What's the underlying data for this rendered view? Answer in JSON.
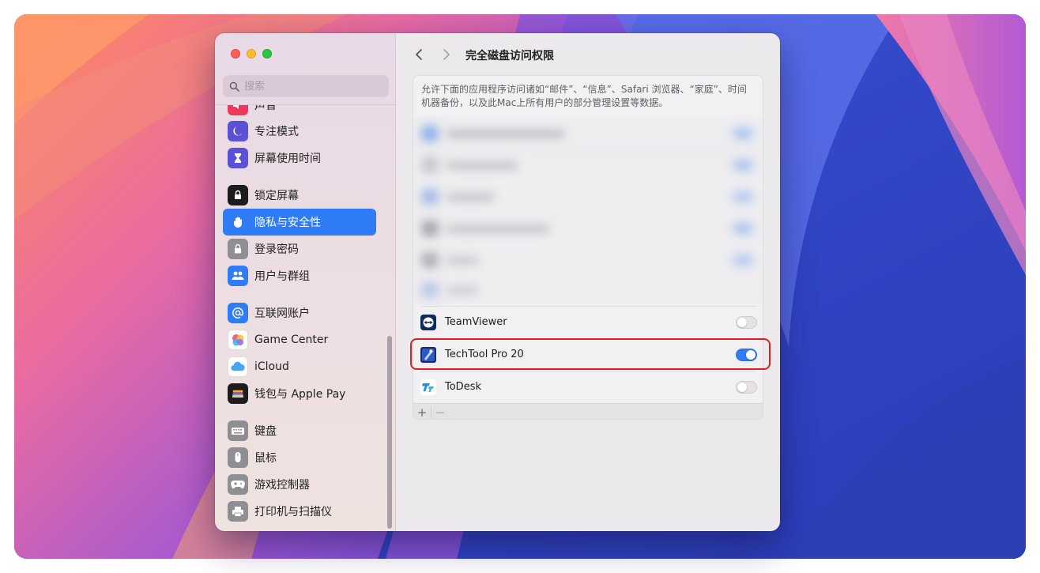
{
  "window": {
    "title": "完全磁盘访问权限"
  },
  "search": {
    "placeholder": "搜索"
  },
  "sidebar": {
    "items": [
      {
        "label": "声音",
        "icon": "sound-icon",
        "color": "#f0385c"
      },
      {
        "label": "专注模式",
        "icon": "moon-icon",
        "color": "#5b50d6"
      },
      {
        "label": "屏幕使用时间",
        "icon": "hourglass-icon",
        "color": "#5b50d6"
      },
      {
        "label": "锁定屏幕",
        "icon": "lock-screen-icon",
        "color": "#1c1c1e"
      },
      {
        "label": "隐私与安全性",
        "icon": "hand-icon",
        "color": "#2f7cf6",
        "active": true
      },
      {
        "label": "登录密码",
        "icon": "padlock-icon",
        "color": "#8e8e93"
      },
      {
        "label": "用户与群组",
        "icon": "users-icon",
        "color": "#2f7cf6"
      },
      {
        "label": "互联网账户",
        "icon": "at-icon",
        "color": "#2f7cf6"
      },
      {
        "label": "Game Center",
        "icon": "game-center-icon",
        "color": "#ffffff"
      },
      {
        "label": "iCloud",
        "icon": "cloud-icon",
        "color": "#ffffff"
      },
      {
        "label": "钱包与 Apple Pay",
        "icon": "wallet-icon",
        "color": "#1c1c1e"
      },
      {
        "label": "键盘",
        "icon": "keyboard-icon",
        "color": "#8e8e93"
      },
      {
        "label": "鼠标",
        "icon": "mouse-icon",
        "color": "#8e8e93"
      },
      {
        "label": "游戏控制器",
        "icon": "gamepad-icon",
        "color": "#8e8e93"
      },
      {
        "label": "打印机与扫描仪",
        "icon": "printer-icon",
        "color": "#8e8e93"
      }
    ]
  },
  "panel": {
    "description": "允许下面的应用程序访问诸如“邮件”、“信息”、Safari 浏览器、“家庭”、时间机器备份，以及此Mac上所有用户的部分管理设置等数据。",
    "apps": [
      {
        "name": "TeamViewer",
        "enabled": false,
        "icon": "teamviewer-icon"
      },
      {
        "name": "TechTool Pro 20",
        "enabled": true,
        "icon": "techtool-icon"
      },
      {
        "name": "ToDesk",
        "enabled": false,
        "icon": "todesk-icon"
      }
    ],
    "footer": {
      "add": "+",
      "remove": "−"
    }
  },
  "colors": {
    "accent": "#2f7cf6",
    "highlight": "#e21d1d"
  }
}
